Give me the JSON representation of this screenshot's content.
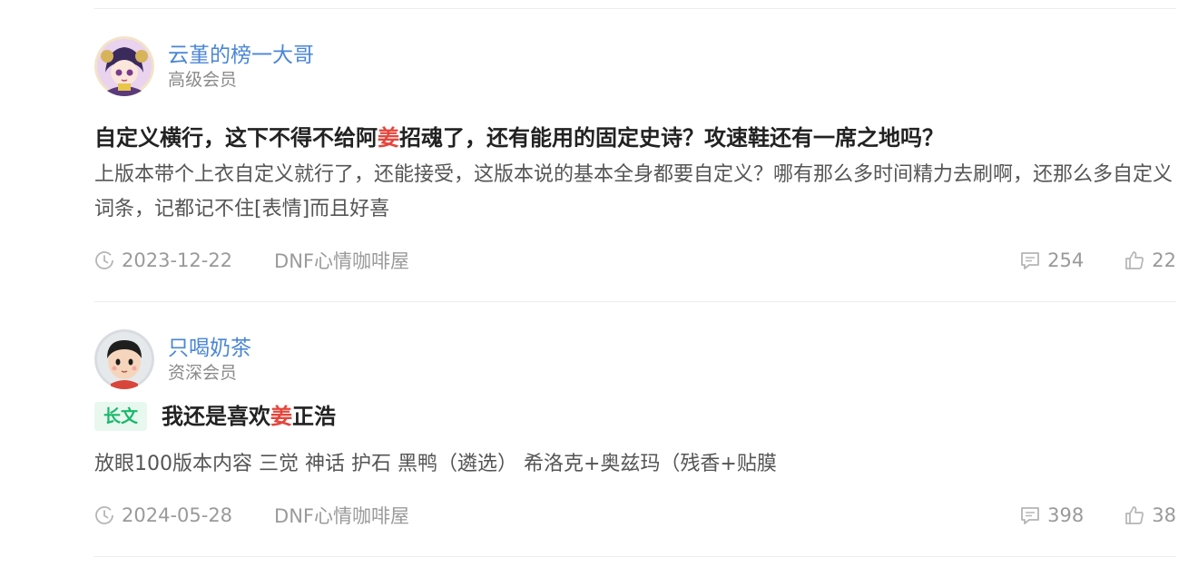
{
  "posts": [
    {
      "author": {
        "name": "云堇的榜一大哥",
        "level": "高级会员"
      },
      "badge": "",
      "title": {
        "before": "自定义横行，这下不得不给阿",
        "highlight": "姜",
        "after": "招魂了，还有能用的固定史诗？攻速鞋还有一席之地吗？"
      },
      "body": "上版本带个上衣自定义就行了，还能接受，这版本说的基本全身都要自定义？哪有那么多时间精力去刷啊，还那么多自定义词条，记都记不住[表情]而且好喜",
      "date": "2023-12-22",
      "source": "DNF心情咖啡屋",
      "comments": "254",
      "likes": "22"
    },
    {
      "author": {
        "name": "只喝奶茶",
        "level": "资深会员"
      },
      "badge": "长文",
      "title": {
        "before": "我还是喜欢",
        "highlight": "姜",
        "after": "正浩"
      },
      "body": "放眼100版本内容 三觉 神话 护石 黑鸭（遴选） 希洛克+奥兹玛（残香+贴膜",
      "date": "2024-05-28",
      "source": "DNF心情咖啡屋",
      "comments": "398",
      "likes": "38"
    }
  ],
  "colors": {
    "author": "#4a86d6",
    "highlight": "#e3463c",
    "badge_text": "#19b86b",
    "badge_bg": "#e8f8ef",
    "meta": "#9a9a9a"
  },
  "icons": {
    "clock": "clock-icon",
    "comment": "comment-icon",
    "like": "thumbs-up-icon"
  }
}
